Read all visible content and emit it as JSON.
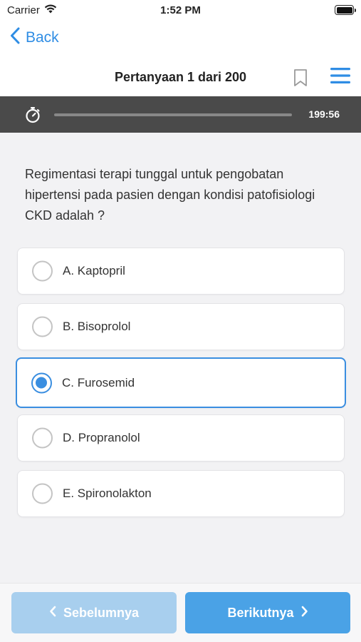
{
  "status_bar": {
    "carrier": "Carrier",
    "time": "1:52 PM",
    "icons": [
      "wifi-icon",
      "battery-icon"
    ]
  },
  "nav": {
    "back_label": "Back",
    "title": "Pertanyaan 1 dari 200",
    "icons": [
      "chevron-left-icon",
      "bookmark-icon",
      "menu-icon"
    ]
  },
  "timer": {
    "remaining": "199:56",
    "progress": 0
  },
  "question": {
    "text": "Regimentasi terapi tunggal untuk pengobatan hipertensi pada pasien dengan kondisi patofisiologi CKD adalah ?"
  },
  "options": [
    {
      "label": "A. Kaptopril",
      "selected": false
    },
    {
      "label": "B. Bisoprolol",
      "selected": false
    },
    {
      "label": "C. Furosemid",
      "selected": true
    },
    {
      "label": "D. Propranolol",
      "selected": false
    },
    {
      "label": "E. Spironolakton",
      "selected": false
    }
  ],
  "footer": {
    "prev_label": "Sebelumnya",
    "next_label": "Berikutnya"
  },
  "colors": {
    "accent": "#3a8ee0",
    "next_button": "#4aa2e6",
    "prev_button_disabled": "#a8cfee",
    "timer_bar": "#4a4a4a"
  }
}
